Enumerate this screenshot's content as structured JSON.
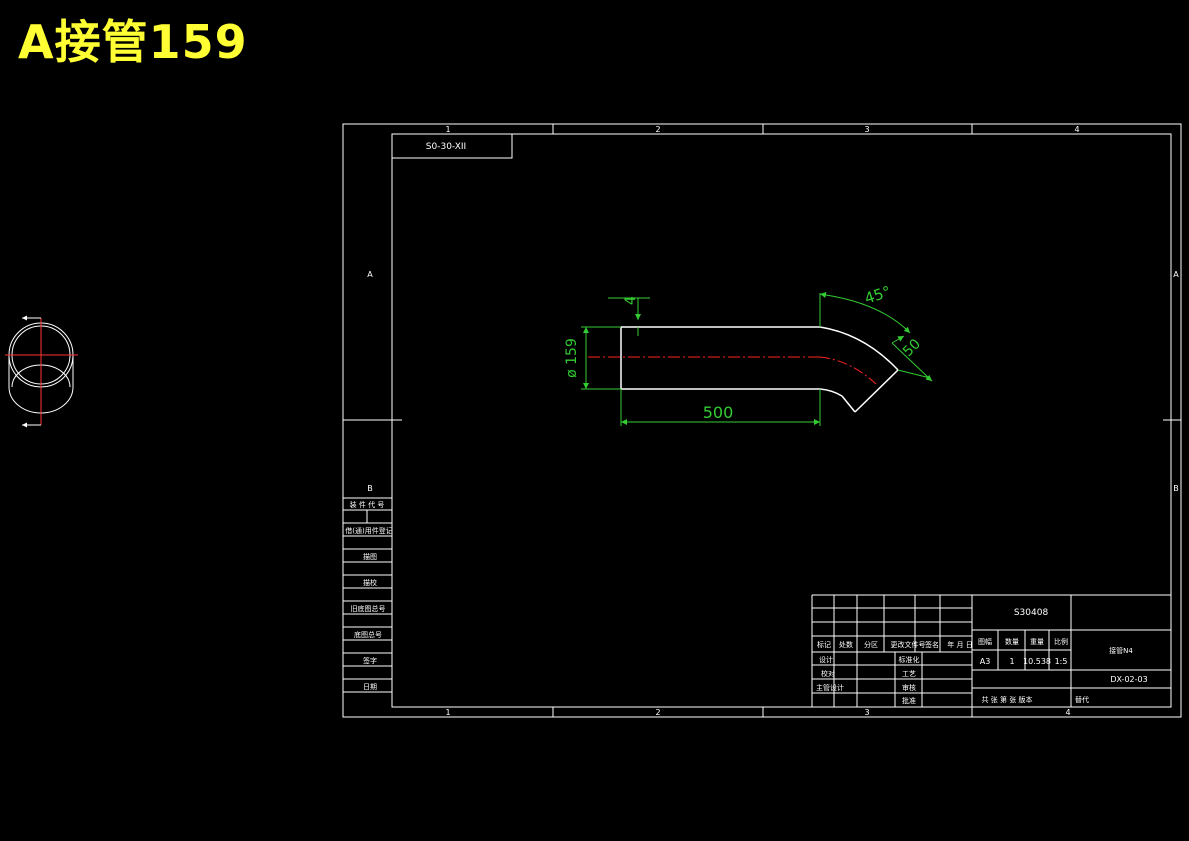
{
  "title": "A接管159",
  "drawing": {
    "code_box": "S0-30-XII",
    "zone_cols": [
      "1",
      "2",
      "3",
      "4"
    ],
    "zone_rows": [
      "A",
      "B"
    ],
    "dims": {
      "thickness": "4",
      "diameter": "ø 159",
      "length": "500",
      "angle": "45°",
      "bend_len": "50"
    },
    "left_table": [
      "装 件 代 号",
      "借(通)用件登记",
      "描图",
      "描校",
      "旧底图总号",
      "底图总号",
      "签字",
      "日期"
    ],
    "title_block": {
      "material": "S30408",
      "change_headers": [
        "标记",
        "处数",
        "分区",
        "更改文件号",
        "签名",
        "年 月 日"
      ],
      "roles_left": [
        "设计",
        "校对",
        "主管设计"
      ],
      "roles_right": [
        "标准化",
        "工艺",
        "审核",
        "批准"
      ],
      "info_headers": [
        "图幅",
        "数量",
        "重量",
        "比例"
      ],
      "info_values": [
        "A3",
        "1",
        "10.538",
        "1:5"
      ],
      "part_name": "接管N4",
      "drawing_no": "DX-02-03",
      "footer_left": "共 张  第 张  版本",
      "footer_right": "替代"
    }
  }
}
